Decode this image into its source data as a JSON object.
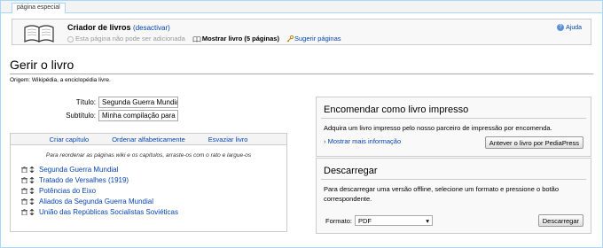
{
  "tab": {
    "label": "página especial"
  },
  "collection": {
    "title": "Criador de livros",
    "deactivate": "(desactivar)",
    "cannot_add": "Esta página não pode ser adicionada",
    "show_book": "Mostrar livro (5 páginas)",
    "suggest": "Sugerir páginas",
    "help": "Ajuda"
  },
  "page": {
    "title": "Gerir o livro",
    "origin": "Origem: Wikipédia, a enciclopédia livre."
  },
  "form": {
    "title_label": "Título:",
    "title_value": "Segunda Guerra Mundial",
    "subtitle_label": "Subtítulo:",
    "subtitle_value": "Minha compilação para"
  },
  "chapters": {
    "toolbar": [
      "Criar capítulo",
      "Ordenar alfabeticamente",
      "Esvaziar livro"
    ],
    "hint": "Para reordenar as páginas wiki e os capítulos, arraste-os com o rato e largue-os",
    "items": [
      "Segunda Guerra Mundial",
      "Tratado de Versalhes (1919)",
      "Potências do Eixo",
      "Aliados da Segunda Guerra Mundial",
      "União das Repúblicas Socialistas Soviéticas"
    ]
  },
  "order_panel": {
    "title": "Encomendar como livro impresso",
    "text": "Adquira um livro impresso pelo nosso parceiro de impressão por encomenda.",
    "more": "Mostrar mais informação",
    "button": "Antever o livro por PediaPress"
  },
  "download_panel": {
    "title": "Descarregar",
    "text": "Para descarregar uma versão offline, selecione um formato e pressione o botão correspondente.",
    "format_label": "Formato:",
    "format_value": "PDF",
    "button": "Descarregar"
  },
  "colors": {
    "link": "#0645ad",
    "border": "#a7d7f9"
  }
}
